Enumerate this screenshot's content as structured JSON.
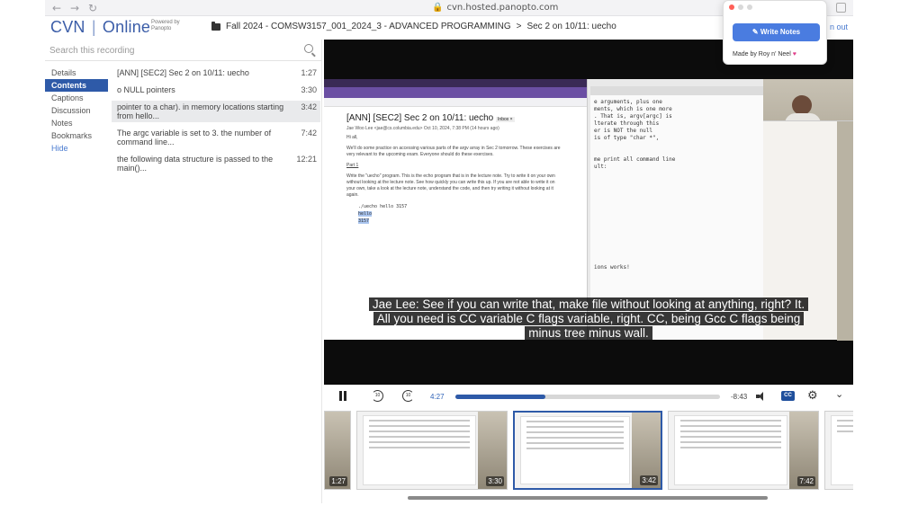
{
  "browser": {
    "url": "cvn.hosted.panopto.com",
    "nav_back": "←",
    "nav_forward": "→",
    "nav_reload": "↻"
  },
  "header": {
    "logo_cvn": "CVN",
    "logo_sep": "|",
    "logo_online": "Online",
    "powered_by_line1": "Powered by",
    "powered_by_line2": "Panopto",
    "breadcrumb_folder": "Fall 2024 - COMSW3157_001_2024_3 - ADVANCED PROGRAMMING",
    "breadcrumb_sep": ">",
    "breadcrumb_session": "Sec 2 on 10/11: uecho",
    "out_link": "n out"
  },
  "search": {
    "placeholder": "Search this recording"
  },
  "nav": {
    "items": [
      {
        "label": "Details"
      },
      {
        "label": "Contents"
      },
      {
        "label": "Captions"
      },
      {
        "label": "Discussion"
      },
      {
        "label": "Notes"
      },
      {
        "label": "Bookmarks"
      },
      {
        "label": "Hide"
      }
    ]
  },
  "contents": [
    {
      "title": "[ANN] [SEC2] Sec 2 on 10/11: uecho",
      "time": "1:27"
    },
    {
      "title": "o NULL pointers",
      "time": "3:30"
    },
    {
      "title": "pointer to a char). in memory locations starting from hello...",
      "time": "3:42"
    },
    {
      "title": "The argc variable is set to 3. the number of command line...",
      "time": "7:42"
    },
    {
      "title": "the following data structure is passed to the main()...",
      "time": "12:21"
    }
  ],
  "email": {
    "subject": "[ANN] [SEC2] Sec 2 on 10/11: uecho",
    "inbox_tag": "Inbox ×",
    "from": "Jae Woo Lee <jae@cs.columbia.edu>   Oct 10, 2024, 7:38 PM (14 hours ago)",
    "greeting": "Hi all,",
    "para1": "We'll do some practice on accessing various parts of the argv array in Sec 2 tomorrow. These exercises are very relevant to the upcoming exam. Everyone should do these exercises.",
    "part": "Part 1",
    "para2": "Write the \"uecho\" program. This is the echo program that is in the lecture note. Try to write it on your own without looking at the lecture note. See how quickly you can write this up. If you are not able to write it on your own, take a look at the lecture note, understand the code, and then try writing it without looking at it again.",
    "code1": "./uecho hello 3157",
    "code2": "hello",
    "code3": "3157"
  },
  "terminal": {
    "lines": "e arguments, plus one\nments, which is one more\n. That is, argv[argc] is\nlterate through this\ner is NOT the null\nis of type \"char *\",\n\n\nme print all command line\nult:\n\n\n\n\n\n\n\n\n\n\n\n\n\nions works!"
  },
  "caption": {
    "line1": "Jae Lee: See if you can write that, make file without looking at anything, right? It.",
    "line2": "All you need is CC variable C flags variable, right. CC, being Gcc C flags being",
    "line3": "minus tree minus wall."
  },
  "player": {
    "current_time": "4:27",
    "remaining_time": "-8:43",
    "progress_fraction": 0.34,
    "rewind_label": "10",
    "forward_label": "10",
    "cc_label": "CC"
  },
  "thumbnails": [
    {
      "time": "1:27"
    },
    {
      "time": "3:30"
    },
    {
      "time": "3:42"
    },
    {
      "time": "7:42"
    },
    {
      "time": ""
    }
  ],
  "extension": {
    "write_notes_label": "Write Notes",
    "made_by": "Made by Roy n' Neel",
    "heart": "♥"
  },
  "colors": {
    "accent": "#2e5aa8",
    "logo": "#3b5da8",
    "link": "#4a7bd0",
    "extension_button": "#4a7ce0"
  }
}
